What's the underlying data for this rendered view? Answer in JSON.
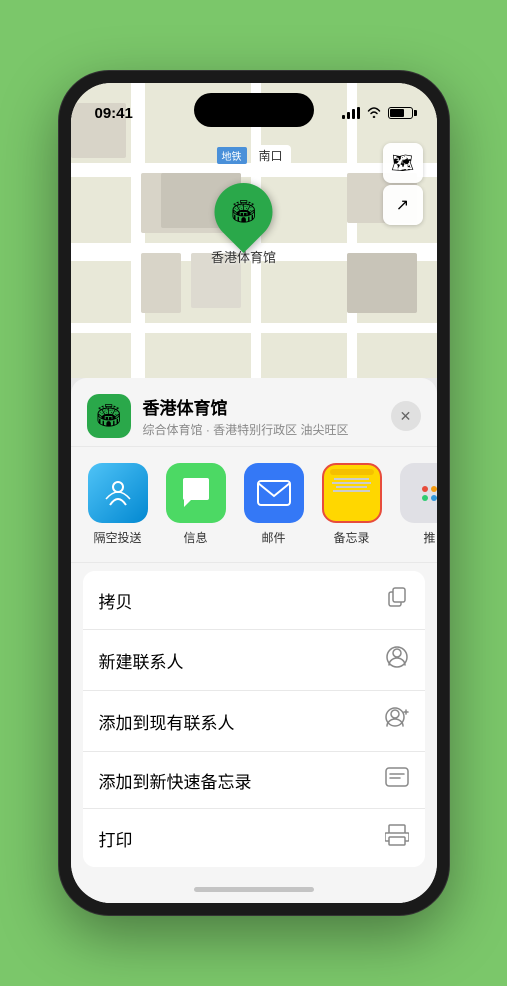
{
  "statusBar": {
    "time": "09:41",
    "locationIndicator": "▸"
  },
  "mapLabels": {
    "entranceLabel": "南口",
    "locationName": "香港体育馆",
    "subtitleLabel": "综合体育馆 · 香港特别行政区 油尖旺区"
  },
  "actions": [
    {
      "id": "airdrop",
      "label": "隔空投送",
      "bgColor": "#0288d1"
    },
    {
      "id": "messages",
      "label": "信息",
      "bgColor": "#4cd964"
    },
    {
      "id": "mail",
      "label": "邮件",
      "bgColor": "#3478f6"
    },
    {
      "id": "notes",
      "label": "备忘录",
      "bgColor": "#ffd700"
    },
    {
      "id": "more",
      "label": "推",
      "bgColor": "#c8c8cc"
    }
  ],
  "menuItems": [
    {
      "id": "copy",
      "label": "拷贝",
      "icon": "⧉"
    },
    {
      "id": "new-contact",
      "label": "新建联系人",
      "icon": "👤"
    },
    {
      "id": "add-contact",
      "label": "添加到现有联系人",
      "icon": "👤"
    },
    {
      "id": "quick-note",
      "label": "添加到新快速备忘录",
      "icon": "⬜"
    },
    {
      "id": "print",
      "label": "打印",
      "icon": "🖨"
    }
  ],
  "sheet": {
    "title": "香港体育馆",
    "subtitle": "综合体育馆 · 香港特别行政区 油尖旺区",
    "closeLabel": "✕"
  },
  "pinLabel": "香港体育馆",
  "mapControls": {
    "mapTypeIcon": "🗺",
    "locationIcon": "⬆"
  }
}
